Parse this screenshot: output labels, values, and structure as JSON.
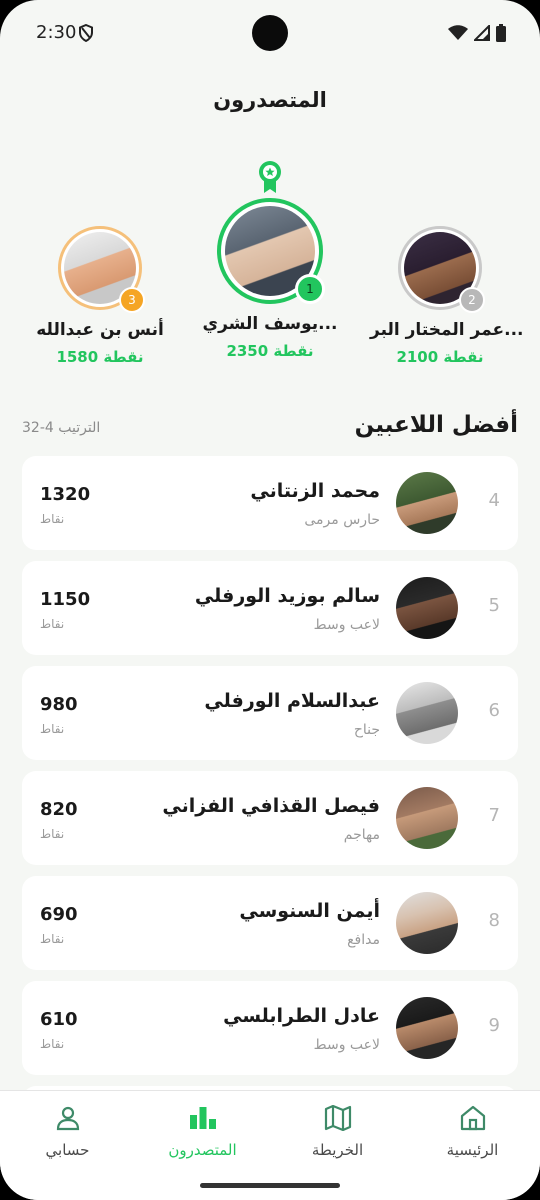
{
  "status_bar": {
    "time": "2:30"
  },
  "page": {
    "title": "المتصدرون"
  },
  "podium": {
    "first": {
      "name": "يوسف الشري...",
      "points": "2350 نقطة",
      "rank": "1"
    },
    "second": {
      "name": "عمر المختار البر...",
      "points": "2100 نقطة",
      "rank": "2"
    },
    "third": {
      "name": "أنس بن عبدالله",
      "points": "1580 نقطة",
      "rank": "3"
    }
  },
  "section": {
    "title": "أفضل اللاعبين",
    "subtitle": "الترتيب 4-32"
  },
  "players": [
    {
      "rank": "4",
      "name": "محمد الزنتاني",
      "role": "حارس مرمى",
      "score": "1320",
      "unit": "نقاط"
    },
    {
      "rank": "5",
      "name": "سالم بوزيد الورفلي",
      "role": "لاعب وسط",
      "score": "1150",
      "unit": "نقاط"
    },
    {
      "rank": "6",
      "name": "عبدالسلام الورفلي",
      "role": "جناح",
      "score": "980",
      "unit": "نقاط"
    },
    {
      "rank": "7",
      "name": "فيصل القذافي الفزاني",
      "role": "مهاجم",
      "score": "820",
      "unit": "نقاط"
    },
    {
      "rank": "8",
      "name": "أيمن السنوسي",
      "role": "مدافع",
      "score": "690",
      "unit": "نقاط"
    },
    {
      "rank": "9",
      "name": "عادل الطرابلسي",
      "role": "لاعب وسط",
      "score": "610",
      "unit": "نقاط"
    }
  ],
  "nav": {
    "account": "حسابي",
    "leaders": "المتصدرون",
    "map": "الخريطة",
    "home": "الرئيسية"
  },
  "colors": {
    "accent": "#22c55e",
    "gold": "#f5a524",
    "silver": "#b8b8b8"
  }
}
